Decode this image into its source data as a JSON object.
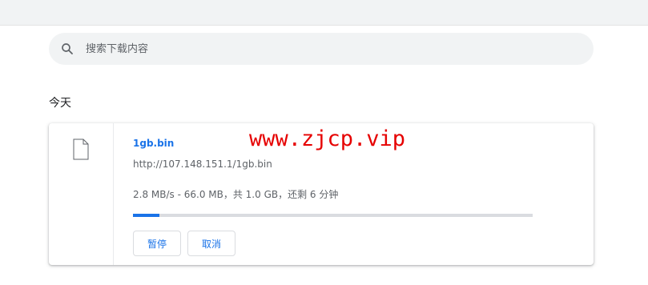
{
  "search": {
    "placeholder": "搜索下载内容",
    "icon": "search-icon"
  },
  "section": {
    "date_header": "今天"
  },
  "download": {
    "icon": "file-icon",
    "filename": "1gb.bin",
    "url": "http://107.148.151.1/1gb.bin",
    "status": "2.8 MB/s - 66.0 MB，共 1.0 GB，还剩 6 分钟",
    "progress_fraction": 0.066,
    "pause_label": "暂停",
    "cancel_label": "取消"
  },
  "watermark": "www.zjcp.vip",
  "colors": {
    "accent": "#1a73e8",
    "watermark": "#e60000"
  }
}
